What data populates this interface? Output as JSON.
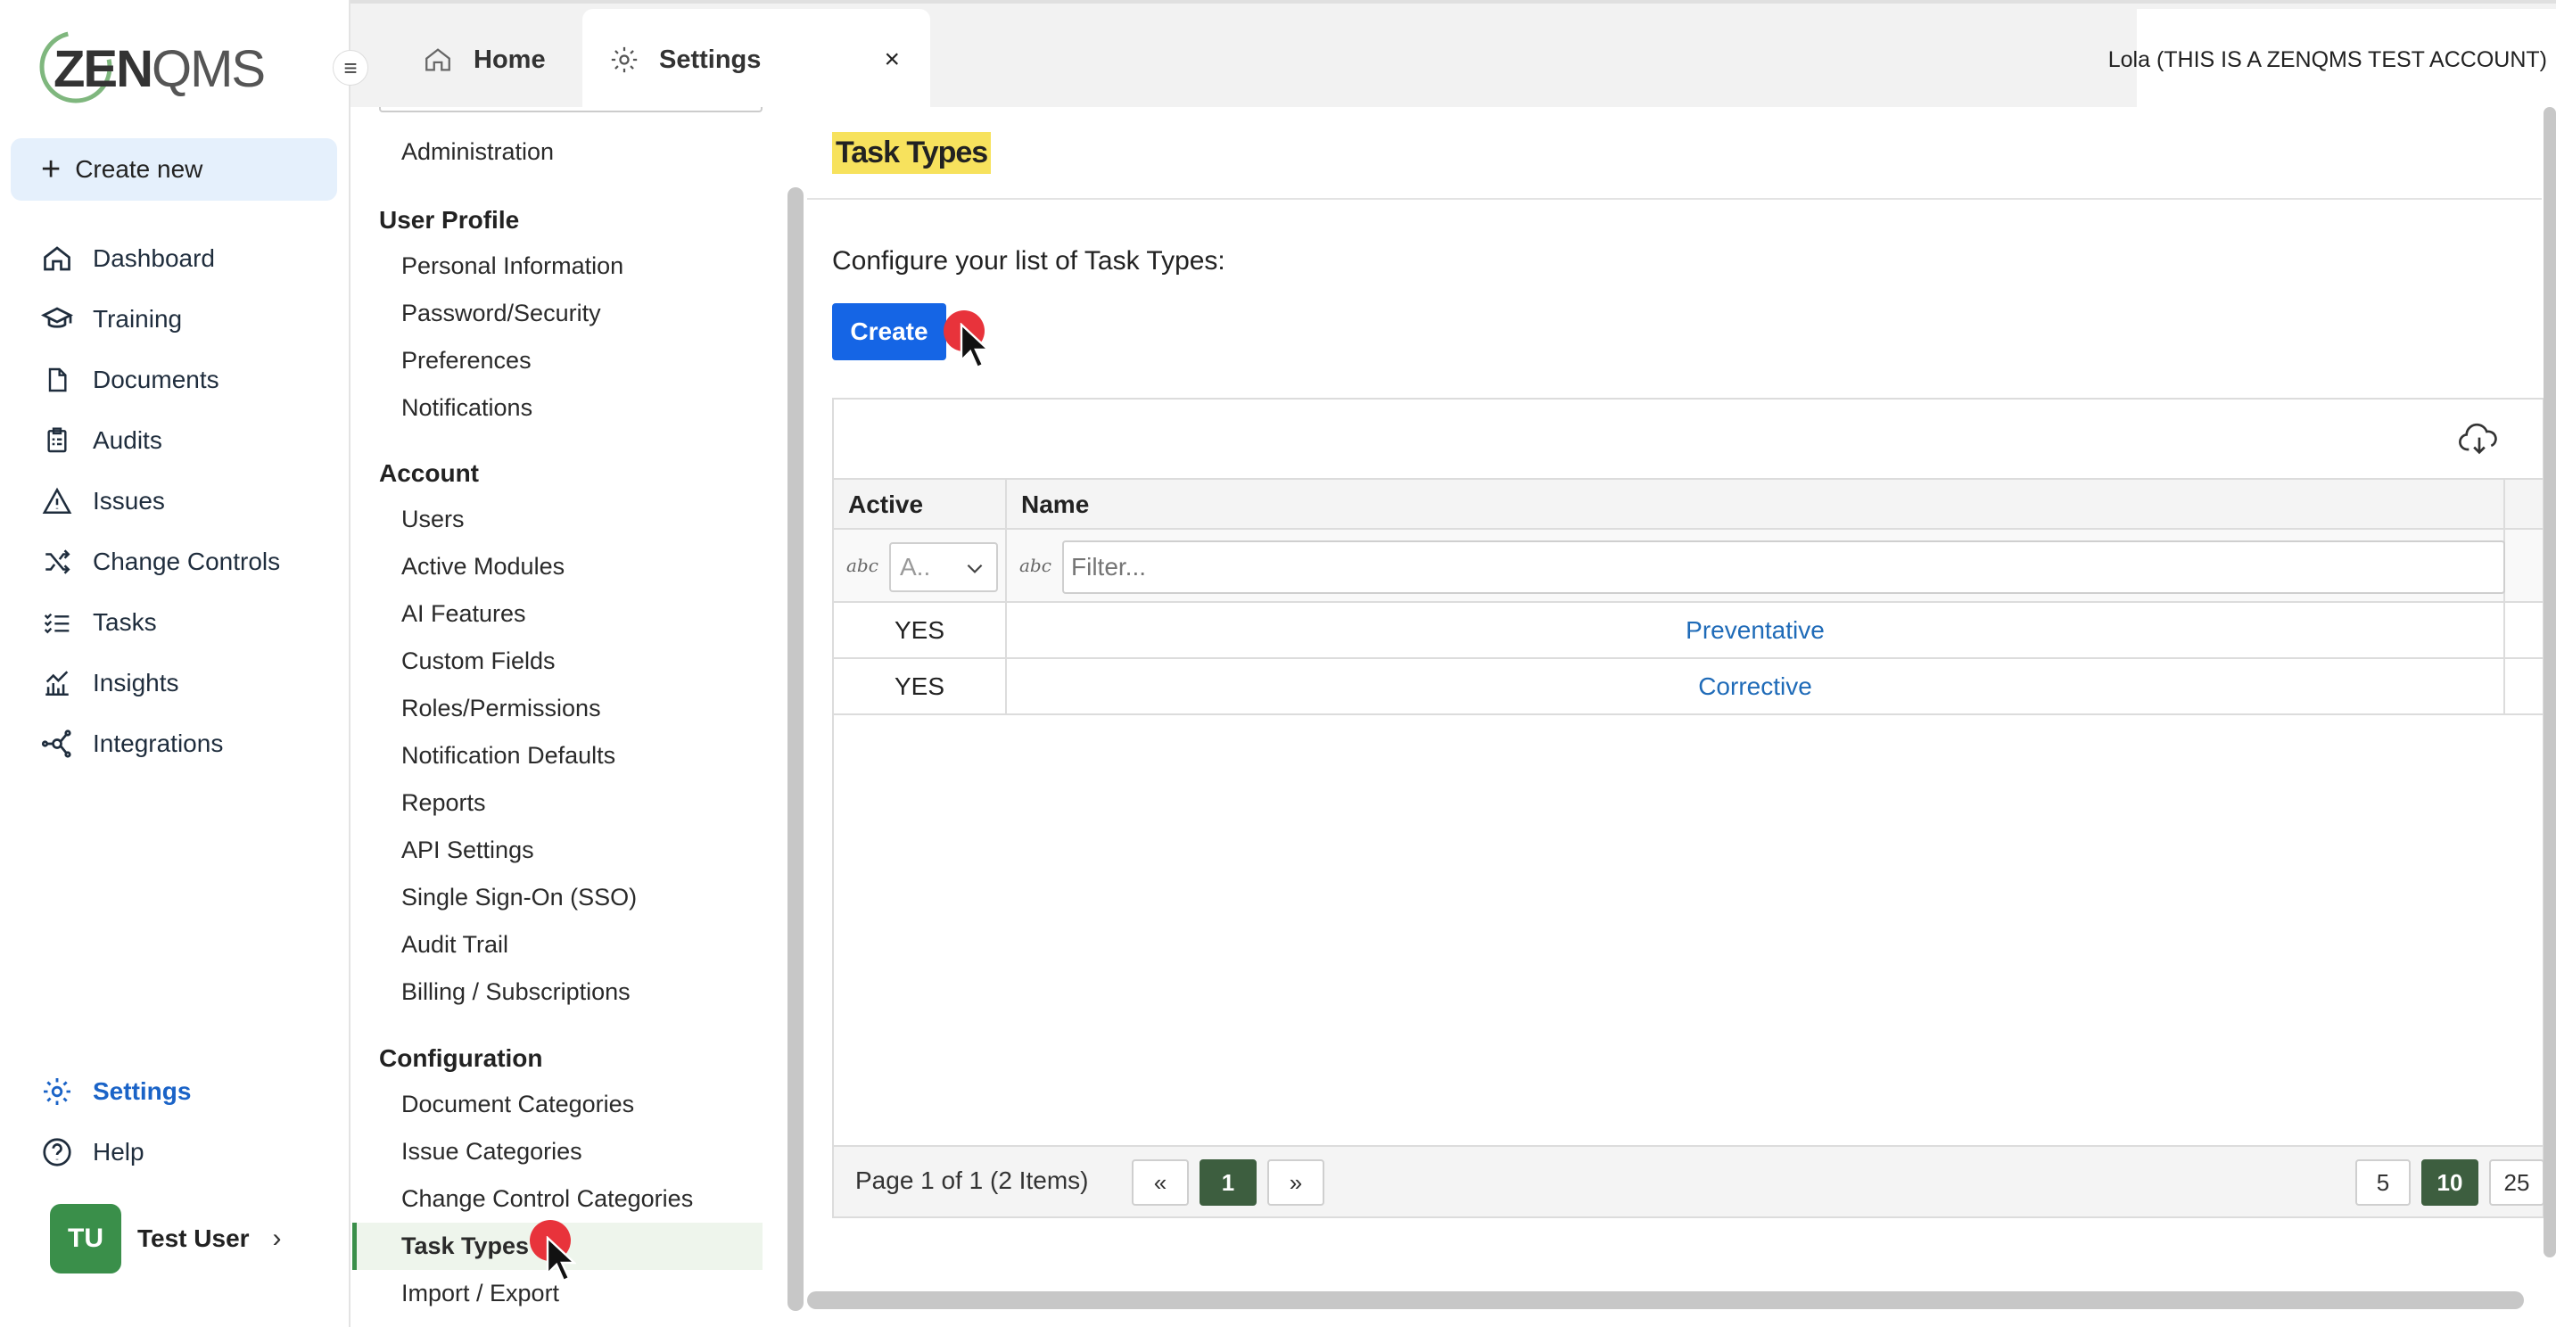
{
  "app": {
    "logo": {
      "text_strong": "ZEN",
      "text_light": "QMS"
    },
    "create_new_label": "Create new",
    "nav": [
      {
        "label": "Dashboard",
        "icon": "home-icon"
      },
      {
        "label": "Training",
        "icon": "graduation-cap-icon"
      },
      {
        "label": "Documents",
        "icon": "document-icon"
      },
      {
        "label": "Audits",
        "icon": "clipboard-icon"
      },
      {
        "label": "Issues",
        "icon": "warning-icon"
      },
      {
        "label": "Change Controls",
        "icon": "shuffle-icon"
      },
      {
        "label": "Tasks",
        "icon": "task-list-icon"
      },
      {
        "label": "Insights",
        "icon": "chart-icon"
      },
      {
        "label": "Integrations",
        "icon": "network-icon"
      }
    ],
    "nav_bottom": [
      {
        "label": "Settings",
        "icon": "gear-icon",
        "active": true
      },
      {
        "label": "Help",
        "icon": "help-circle-icon"
      }
    ],
    "user": {
      "initials": "TU",
      "name": "Test User"
    }
  },
  "tabs": {
    "home_label": "Home",
    "settings_label": "Settings",
    "close_symbol": "×",
    "account_label": "Lola (THIS IS A ZENQMS TEST ACCOUNT)"
  },
  "settings_nav": {
    "top_item": "Administration",
    "groups": [
      {
        "header": "User Profile",
        "items": [
          "Personal Information",
          "Password/Security",
          "Preferences",
          "Notifications"
        ]
      },
      {
        "header": "Account",
        "items": [
          "Users",
          "Active Modules",
          "AI Features",
          "Custom Fields",
          "Roles/Permissions",
          "Notification Defaults",
          "Reports",
          "API Settings",
          "Single Sign-On (SSO)",
          "Audit Trail",
          "Billing / Subscriptions"
        ]
      },
      {
        "header": "Configuration",
        "items": [
          "Document Categories",
          "Issue Categories",
          "Change Control Categories",
          "Task Types",
          "Import / Export"
        ]
      }
    ],
    "active_item": "Task Types"
  },
  "main": {
    "title": "Task Types",
    "intro": "Configure your list of Task Types:",
    "create_label": "Create",
    "grid": {
      "columns": [
        "Active",
        "Name"
      ],
      "filter_select_value": "A..",
      "filter_placeholder": "Filter...",
      "abc_icon": "abc",
      "rows": [
        {
          "active": "YES",
          "name": "Preventative"
        },
        {
          "active": "YES",
          "name": "Corrective"
        }
      ],
      "pager": {
        "info": "Page 1 of 1 (2 Items)",
        "prev": "«",
        "current": "1",
        "next": "»",
        "sizes": [
          "5",
          "10",
          "25"
        ],
        "active_size": "10"
      }
    }
  },
  "colors": {
    "accent": "#1565e5",
    "settings_active": "#1a63c7",
    "highlight": "#f7e25d",
    "green": "#3a8f4a",
    "link": "#1f6bb8"
  }
}
